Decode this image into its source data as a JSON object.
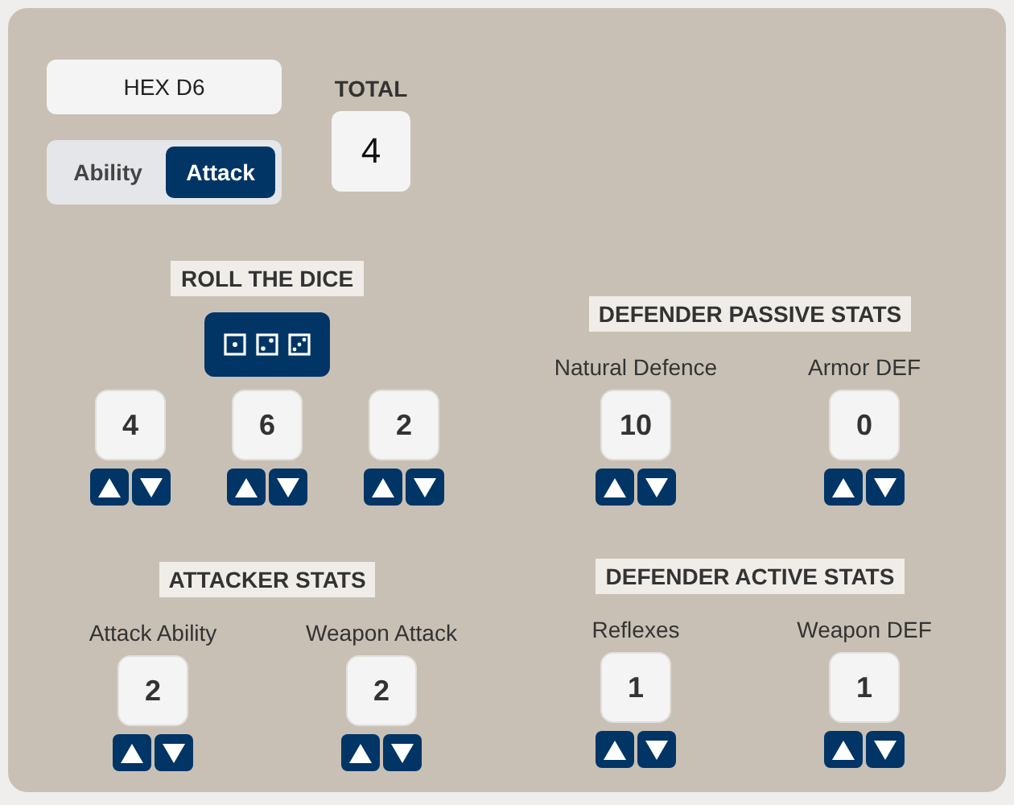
{
  "title": "HEX D6",
  "modes": [
    {
      "label": "Ability",
      "selected": false
    },
    {
      "label": "Attack",
      "selected": true
    }
  ],
  "total": {
    "label": "TOTAL",
    "value": "4"
  },
  "dice": {
    "label": "ROLL THE DICE",
    "values": [
      "4",
      "6",
      "2"
    ]
  },
  "groups": [
    {
      "title": "DEFENDER PASSIVE STATS",
      "stats": [
        {
          "label": "Natural Defence",
          "value": "10"
        },
        {
          "label": "Armor DEF",
          "value": "0"
        }
      ]
    },
    {
      "title": "ATTACKER STATS",
      "stats": [
        {
          "label": "Attack Ability",
          "value": "2"
        },
        {
          "label": "Weapon Attack",
          "value": "2"
        }
      ]
    },
    {
      "title": "DEFENDER ACTIVE STATS",
      "stats": [
        {
          "label": "Reflexes",
          "value": "1"
        },
        {
          "label": "Weapon DEF",
          "value": "1"
        }
      ]
    }
  ]
}
